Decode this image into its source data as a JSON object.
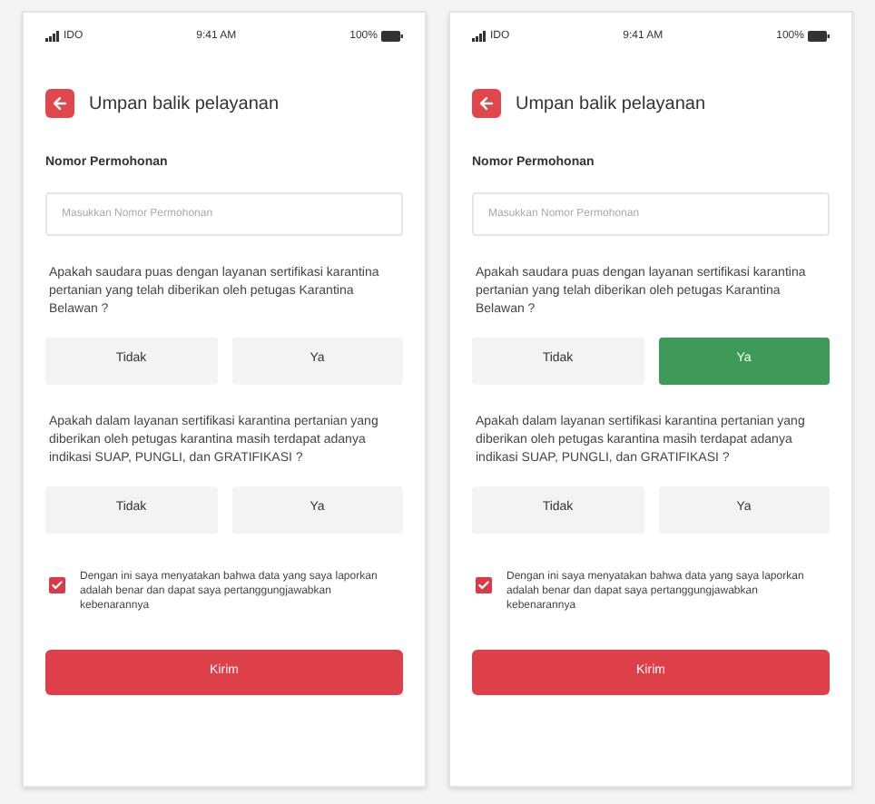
{
  "screens": [
    {
      "status_bar": {
        "carrier": "IDO",
        "time": "9:41 AM",
        "battery": "100%"
      },
      "header": {
        "title": "Umpan balik pelayanan"
      },
      "field": {
        "label": "Nomor Permohonan",
        "placeholder": "Masukkan Nomor Permohonan"
      },
      "questions": [
        {
          "text": "Apakah saudara puas dengan layanan sertifikasi karantina pertanian yang telah diberikan oleh petugas Karantina Belawan ?",
          "options": [
            {
              "label": "Tidak",
              "selected": false
            },
            {
              "label": "Ya",
              "selected": false
            }
          ]
        },
        {
          "text": "Apakah dalam layanan sertifikasi karantina pertanian yang diberikan oleh petugas karantina masih terdapat adanya indikasi SUAP, PUNGLI, dan GRATIFIKASI ?",
          "options": [
            {
              "label": "Tidak",
              "selected": false
            },
            {
              "label": "Ya",
              "selected": false
            }
          ]
        }
      ],
      "agreement": {
        "text": "Dengan ini saya menyatakan bahwa data yang saya laporkan adalah benar dan dapat saya pertanggungjawabkan kebenarannya",
        "checked": true
      },
      "submit": "Kirim"
    },
    {
      "status_bar": {
        "carrier": "IDO",
        "time": "9:41 AM",
        "battery": "100%"
      },
      "header": {
        "title": "Umpan balik pelayanan"
      },
      "field": {
        "label": "Nomor Permohonan",
        "placeholder": "Masukkan Nomor Permohonan"
      },
      "questions": [
        {
          "text": "Apakah saudara puas dengan layanan sertifikasi karantina pertanian yang telah diberikan oleh petugas Karantina Belawan ?",
          "options": [
            {
              "label": "Tidak",
              "selected": false
            },
            {
              "label": "Ya",
              "selected": true
            }
          ]
        },
        {
          "text": "Apakah dalam layanan sertifikasi karantina pertanian yang diberikan oleh petugas karantina masih terdapat adanya indikasi SUAP, PUNGLI, dan GRATIFIKASI ?",
          "options": [
            {
              "label": "Tidak",
              "selected": false
            },
            {
              "label": "Ya",
              "selected": false
            }
          ]
        }
      ],
      "agreement": {
        "text": "Dengan ini saya menyatakan bahwa data yang saya laporkan adalah benar dan dapat saya pertanggungjawabkan kebenarannya",
        "checked": true
      },
      "submit": "Kirim"
    }
  ]
}
